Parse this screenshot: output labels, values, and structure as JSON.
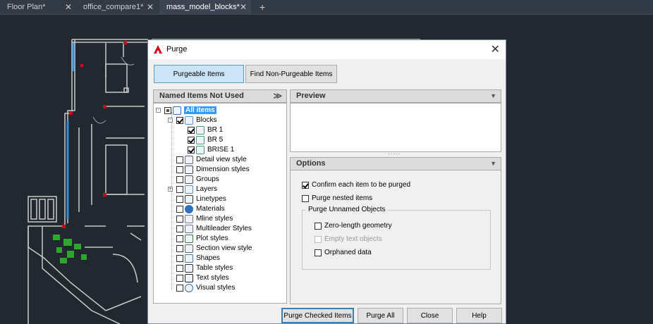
{
  "tabs": [
    {
      "label": "Floor Plan*",
      "active": false
    },
    {
      "label": "office_compare1*",
      "active": false
    },
    {
      "label": "mass_model_blocks*",
      "active": true
    }
  ],
  "tab_close_glyph": "✕",
  "new_tab_glyph": "+",
  "dialog": {
    "title": "Purge",
    "close_glyph": "✕",
    "tab_buttons": {
      "purgeable": "Purgeable Items",
      "non_purgeable": "Find Non-Purgeable Items"
    },
    "left_panel": {
      "header": "Named Items Not Used",
      "header_icon": "double-chevron-down-icon",
      "tree": [
        {
          "label": "All items",
          "level": 0,
          "checkbox": "partial",
          "selected": true,
          "expander": "-",
          "icon": "all-items-icon"
        },
        {
          "label": "Blocks",
          "level": 1,
          "checkbox": "checked",
          "expander": "-",
          "icon": "blocks-icon"
        },
        {
          "label": "BR 1",
          "level": 2,
          "checkbox": "checked",
          "icon": "block-icon"
        },
        {
          "label": "BR 5",
          "level": 2,
          "checkbox": "checked",
          "icon": "block-icon"
        },
        {
          "label": "BRISE 1",
          "level": 2,
          "checkbox": "checked",
          "icon": "block-icon"
        },
        {
          "label": "Detail view style",
          "level": 1,
          "checkbox": "unchecked",
          "icon": "detail-view-icon"
        },
        {
          "label": "Dimension styles",
          "level": 1,
          "checkbox": "unchecked",
          "icon": "dimension-icon"
        },
        {
          "label": "Groups",
          "level": 1,
          "checkbox": "unchecked",
          "icon": "groups-icon"
        },
        {
          "label": "Layers",
          "level": 1,
          "checkbox": "unchecked",
          "expander": "+",
          "icon": "layers-icon"
        },
        {
          "label": "Linetypes",
          "level": 1,
          "checkbox": "unchecked",
          "icon": "linetypes-icon"
        },
        {
          "label": "Materials",
          "level": 1,
          "checkbox": "unchecked",
          "icon": "materials-icon"
        },
        {
          "label": "Mline styles",
          "level": 1,
          "checkbox": "unchecked",
          "icon": "mline-icon"
        },
        {
          "label": "Multileader Styles",
          "level": 1,
          "checkbox": "unchecked",
          "icon": "multileader-icon"
        },
        {
          "label": "Plot styles",
          "level": 1,
          "checkbox": "unchecked",
          "icon": "plot-styles-icon"
        },
        {
          "label": "Section view style",
          "level": 1,
          "checkbox": "unchecked",
          "icon": "section-view-icon"
        },
        {
          "label": "Shapes",
          "level": 1,
          "checkbox": "unchecked",
          "icon": "shapes-icon"
        },
        {
          "label": "Table styles",
          "level": 1,
          "checkbox": "unchecked",
          "icon": "table-styles-icon"
        },
        {
          "label": "Text styles",
          "level": 1,
          "checkbox": "unchecked",
          "icon": "text-styles-icon"
        },
        {
          "label": "Visual styles",
          "level": 1,
          "checkbox": "unchecked",
          "icon": "visual-styles-icon"
        }
      ]
    },
    "preview": {
      "header": "Preview",
      "arrow_glyph": "▼"
    },
    "options": {
      "header": "Options",
      "arrow_glyph": "▼",
      "confirm": {
        "label": "Confirm each item to be purged",
        "checked": true
      },
      "nested": {
        "label": "Purge nested items",
        "checked": false
      },
      "unnamed_group": "Purge Unnamed Objects",
      "zero_length": {
        "label": "Zero-length geometry",
        "checked": false
      },
      "empty_text": {
        "label": "Empty text objects",
        "checked": false,
        "disabled": true
      },
      "orphaned": {
        "label": "Orphaned data",
        "checked": false
      }
    },
    "buttons": {
      "purge_checked": "Purge Checked Items",
      "purge_all": "Purge All",
      "close": "Close",
      "help": "Help"
    }
  },
  "colors": {
    "background": "#212830",
    "wall": "#c9c9c9",
    "accent_red": "#d0001b",
    "selection": "#3399ff",
    "plants": "#2ea62e"
  }
}
